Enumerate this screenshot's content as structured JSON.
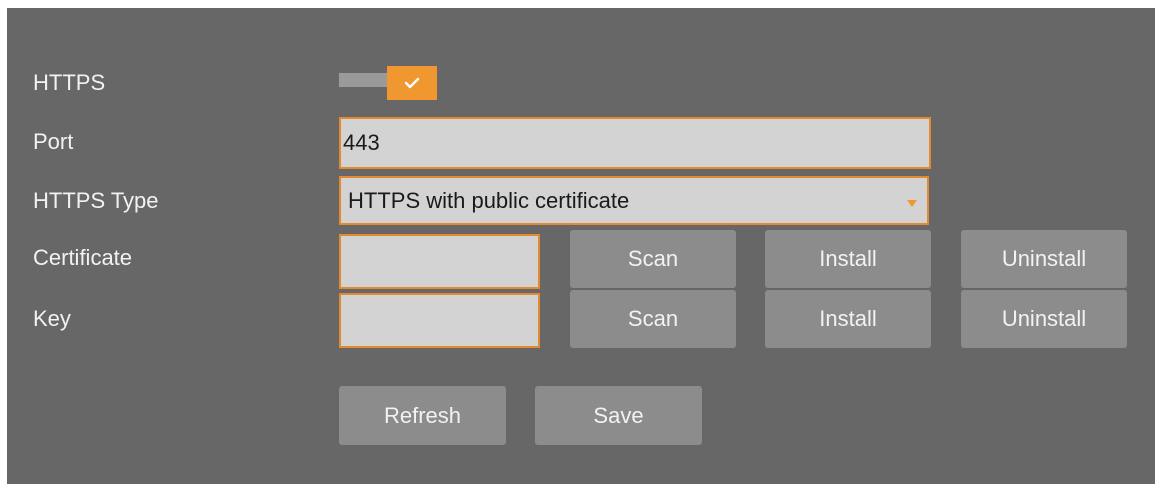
{
  "labels": {
    "https": "HTTPS",
    "port": "Port",
    "https_type": "HTTPS Type",
    "certificate": "Certificate",
    "key": "Key"
  },
  "https_toggle": {
    "enabled": true,
    "icon": "checkmark-icon"
  },
  "port": {
    "value": "443"
  },
  "https_type": {
    "selected": "HTTPS with public certificate"
  },
  "certificate": {
    "value": "",
    "scan_label": "Scan",
    "install_label": "Install",
    "uninstall_label": "Uninstall"
  },
  "key": {
    "value": "",
    "scan_label": "Scan",
    "install_label": "Install",
    "uninstall_label": "Uninstall"
  },
  "actions": {
    "refresh_label": "Refresh",
    "save_label": "Save"
  },
  "colors": {
    "panel": "#676767",
    "accent": "#f0982f",
    "field": "#d3d3d3",
    "button": "#8c8c8c"
  }
}
